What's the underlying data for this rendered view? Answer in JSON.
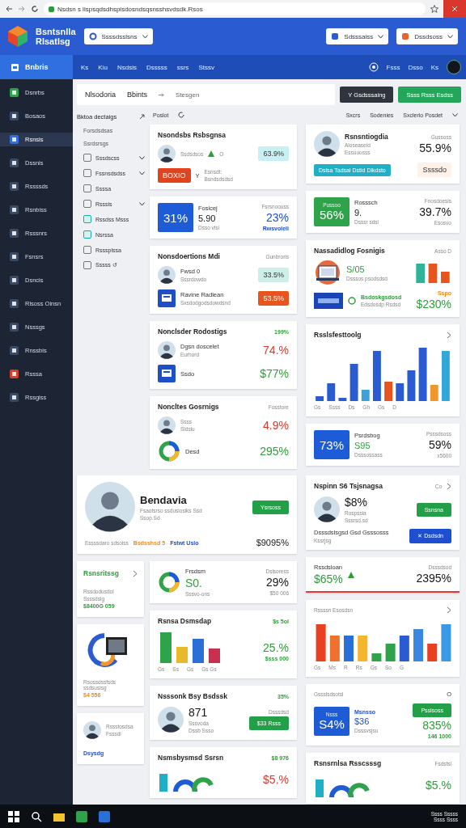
{
  "browser": {
    "url": "Nsdsn s llspsqdsdhsplsdosndsqsnsshsvdsdk.Rsos"
  },
  "header": {
    "app_name": [
      "Bsntsnlla",
      "Rlsatlsg"
    ],
    "workspace_select": "Ssssdsslsns",
    "right_selects": [
      "Sdsssaiss",
      "Dssdsoss"
    ]
  },
  "nav": {
    "home": "Bnbris",
    "items": [
      "Ks",
      "Kiu",
      "Nsdsis",
      "Dsssss",
      "ssrs",
      "Stssv"
    ],
    "right_items": [
      "Fsss",
      "Dsso",
      "Ks"
    ]
  },
  "sidebar": {
    "items": [
      {
        "label": "Dsnrbs",
        "selected": false,
        "color": "#2fa34a"
      },
      {
        "label": "Bosaos",
        "selected": false,
        "color": "#3a4a63"
      },
      {
        "label": "Rsnsis",
        "selected": true,
        "color": "#2f6fe0"
      },
      {
        "label": "Dssnis",
        "selected": false,
        "color": "#3a4a63"
      },
      {
        "label": "Rssssds",
        "selected": false,
        "color": "#3a4a63"
      },
      {
        "label": "Rsnbiss",
        "selected": false,
        "color": "#3a4a63"
      },
      {
        "label": "Rsssnrs",
        "selected": false,
        "color": "#3a4a63"
      },
      {
        "label": "Fsnsrs",
        "selected": false,
        "color": "#3a4a63"
      },
      {
        "label": "Dsncis",
        "selected": false,
        "color": "#3a4a63"
      },
      {
        "label": "Rlsoss Oinsn",
        "selected": false,
        "color": "#3a4a63"
      },
      {
        "label": "Nsssgs",
        "selected": false,
        "color": "#3a4a63"
      },
      {
        "label": "Rnssbis",
        "selected": false,
        "color": "#3a4a63"
      },
      {
        "label": "Rsssa",
        "selected": false,
        "color": "#d6402b"
      },
      {
        "label": "Rssgiss",
        "selected": false,
        "color": "#3a4a63"
      }
    ]
  },
  "toolbar": {
    "breadcrumb": [
      "Nlsodoria",
      "Bbints",
      "Stesgen"
    ],
    "buttons": [
      {
        "label": "Y Gsdsssaing",
        "color": "#30343c"
      },
      {
        "label": "Ssss Rsss Esdss",
        "color": "#23a55a"
      }
    ]
  },
  "tree": {
    "title": "Bktoa dectaigs",
    "items": [
      {
        "label": "Forsdsdsas",
        "kind": "heading"
      },
      {
        "label": "Ssrdsrsgs",
        "kind": "heading"
      },
      {
        "label": "Sssdscss",
        "kind": "group"
      },
      {
        "label": "Fssnsdsdss",
        "kind": "group"
      },
      {
        "label": "Ssssa",
        "kind": "leaf"
      },
      {
        "label": "Rsssis",
        "kind": "group"
      },
      {
        "label": "Rssdss Msss",
        "kind": "teal"
      },
      {
        "label": "Nsrssa",
        "kind": "teal"
      },
      {
        "label": "Rsssplssa",
        "kind": "leaf"
      },
      {
        "label": "Sssss ↺",
        "kind": "leaf"
      }
    ]
  },
  "filter_bar": {
    "left": "Poslot",
    "right": [
      "Sxcrs",
      "Sodenies",
      "Sxclerio Posdet"
    ]
  },
  "columns": {
    "a": [
      {
        "rows": [
          {
            "left": [
              {
                "kind": "title",
                "text": "Nsondsbs Rsbsgnsa"
              }
            ]
          },
          {
            "left": [
              {
                "kind": "avatar"
              },
              {
                "kind": "muted",
                "text": "Ssdsdsos"
              },
              {
                "kind": "up-icon"
              },
              {
                "kind": "muted",
                "text": "O"
              }
            ],
            "right": [
              {
                "kind": "badge",
                "text": "63.9%",
                "color": "#c8f0f2"
              }
            ]
          },
          {
            "left": [
              {
                "kind": "badge",
                "text": "BOXIO",
                "color": "#e0431d"
              },
              {
                "kind": "text",
                "text": "Y"
              },
              {
                "kind": "stack",
                "lines": [
                  {
                    "kind": "muted",
                    "text": "Esnsdt:"
                  },
                  {
                    "kind": "muted",
                    "text": "Bsndsdsdsd"
                  }
                ]
              }
            ]
          }
        ]
      },
      {
        "rows": [
          {
            "left": [
              {
                "kind": "tile",
                "color": "#1e5bd6",
                "lines": [
                  {
                    "kind": "tile-value",
                    "text": "31%"
                  }
                ]
              },
              {
                "kind": "stack",
                "lines": [
                  {
                    "kind": "text",
                    "text": "Fosicej"
                  },
                  {
                    "kind": "value-sm",
                    "text": "5.90"
                  },
                  {
                    "kind": "muted",
                    "text": "Dsso vlsi"
                  }
                ]
              }
            ],
            "right": [
              {
                "kind": "stack",
                "lines": [
                  {
                    "kind": "muted",
                    "text": "Fsrsnoouss"
                  },
                  {
                    "kind": "value-blue",
                    "text": "23%"
                  },
                  {
                    "kind": "small-blue",
                    "text": "Rwsvoleli"
                  }
                ]
              }
            ]
          }
        ]
      },
      {
        "rows": [
          {
            "left": [
              {
                "kind": "title",
                "text": "Nonsdoertions Mdi"
              }
            ],
            "right": [
              {
                "kind": "muted",
                "text": "Gunbroris"
              }
            ]
          },
          {
            "left": [
              {
                "kind": "avatar"
              },
              {
                "kind": "stack",
                "lines": [
                  {
                    "kind": "text",
                    "text": "Fwsd 0"
                  },
                  {
                    "kind": "muted",
                    "text": "Sssrdowdo"
                  }
                ]
              }
            ],
            "right": [
              {
                "kind": "badge",
                "text": "33.5%",
                "color": "#cdeee9"
              }
            ]
          },
          {
            "left": [
              {
                "kind": "app-icon"
              },
              {
                "kind": "stack",
                "lines": [
                  {
                    "kind": "text",
                    "text": "Ravine Radlean"
                  },
                  {
                    "kind": "muted",
                    "text": "Sxsdodgodsdowdsnd"
                  }
                ]
              }
            ],
            "right": [
              {
                "kind": "badge",
                "text": "53.5%",
                "color": "#e8541e"
              }
            ]
          }
        ]
      },
      {
        "rows": [
          {
            "left": [
              {
                "kind": "title",
                "text": "Nonclsder Rodostigs"
              }
            ],
            "right": [
              {
                "kind": "small-green",
                "text": "199%"
              }
            ]
          },
          {
            "left": [
              {
                "kind": "avatar"
              },
              {
                "kind": "stack",
                "lines": [
                  {
                    "kind": "text",
                    "text": "Dgsn doscelet"
                  },
                  {
                    "kind": "muted",
                    "text": "Eurhord"
                  }
                ]
              }
            ],
            "right": [
              {
                "kind": "value-red",
                "text": "74.%"
              }
            ]
          },
          {
            "left": [
              {
                "kind": "app-icon"
              },
              {
                "kind": "text",
                "text": "Ssdo"
              }
            ],
            "right": [
              {
                "kind": "value-green",
                "text": "$77%"
              }
            ]
          }
        ]
      },
      {
        "rows": [
          {
            "left": [
              {
                "kind": "title",
                "text": "Noncltes Gosrnigs"
              }
            ],
            "right": [
              {
                "kind": "muted",
                "text": "Fosstore"
              }
            ]
          },
          {
            "left": [
              {
                "kind": "avatar"
              },
              {
                "kind": "stack",
                "lines": [
                  {
                    "kind": "muted",
                    "text": "Ssss"
                  },
                  {
                    "kind": "muted",
                    "text": "Sldsiu"
                  }
                ]
              }
            ],
            "right": [
              {
                "kind": "value-red",
                "text": "4.9%"
              }
            ]
          },
          {
            "left": [
              {
                "kind": "donut-drawing"
              },
              {
                "kind": "text",
                "text": "Desd"
              }
            ],
            "right": [
              {
                "kind": "value-green",
                "text": "295%"
              }
            ]
          }
        ]
      }
    ],
    "b": [
      {
        "rows": [
          {
            "left": [
              {
                "kind": "avatar-lg"
              },
              {
                "kind": "stack",
                "lines": [
                  {
                    "kind": "title",
                    "text": "Rsnsntiogdia"
                  },
                  {
                    "kind": "muted",
                    "text": "Aloseaseld"
                  },
                  {
                    "kind": "muted",
                    "text": "Essuuosss"
                  }
                ]
              }
            ],
            "right": [
              {
                "kind": "stack",
                "lines": [
                  {
                    "kind": "muted",
                    "text": "Gussoss"
                  },
                  {
                    "kind": "value",
                    "text": "55.9%"
                  }
                ]
              }
            ]
          },
          {
            "left": [
              {
                "kind": "badge",
                "text": "Dslsa Tadsal Dstid Dikdsto",
                "color": "#1fb0c8"
              }
            ],
            "right": [
              {
                "kind": "badge",
                "text": "Ssssdo",
                "color": "#fdf1e8"
              }
            ]
          }
        ]
      },
      {
        "rows": [
          {
            "left": [
              {
                "kind": "tile",
                "color": "#2fa34a",
                "lines": [
                  {
                    "kind": "tile-small",
                    "text": "Pussoo"
                  },
                  {
                    "kind": "tile-value",
                    "text": "56%"
                  }
                ]
              },
              {
                "kind": "stack",
                "lines": [
                  {
                    "kind": "text",
                    "text": "Rosssch"
                  },
                  {
                    "kind": "value-sm",
                    "text": "9."
                  },
                  {
                    "kind": "muted",
                    "text": "Dsssr sdsi"
                  }
                ]
              }
            ],
            "right": [
              {
                "kind": "stack",
                "lines": [
                  {
                    "kind": "muted",
                    "text": "Fnosdoesis"
                  },
                  {
                    "kind": "value",
                    "text": "39.7%"
                  },
                  {
                    "kind": "muted",
                    "text": "Esosvo"
                  }
                ]
              }
            ]
          }
        ]
      },
      {
        "rows": [
          {
            "left": [
              {
                "kind": "title",
                "text": "Nassadidlog Fosnigis"
              }
            ],
            "right": [
              {
                "kind": "muted",
                "text": "Asso D"
              }
            ]
          },
          {
            "left": [
              {
                "kind": "device-drawing"
              },
              {
                "kind": "stack",
                "lines": [
                  {
                    "kind": "value-green-sm",
                    "text": "S/05"
                  },
                  {
                    "kind": "muted",
                    "text": "Dsssos psodsdsd"
                  }
                ]
              }
            ],
            "right": [
              {
                "kind": "bars-mini"
              }
            ]
          },
          {
            "left": [
              {
                "kind": "logo-tile"
              },
              {
                "kind": "dollar-icon"
              },
              {
                "kind": "stack",
                "lines": [
                  {
                    "kind": "small-green",
                    "text": "Bsdoskgsdosd"
                  },
                  {
                    "kind": "muted",
                    "text": "Edsdosdp Rsdsd"
                  }
                ]
              }
            ],
            "right": [
              {
                "kind": "stack",
                "lines": [
                  {
                    "kind": "small-orange",
                    "text": "Sspo"
                  },
                  {
                    "kind": "value-green",
                    "text": "$230%"
                  }
                ]
              }
            ]
          }
        ]
      },
      {
        "rows": [
          {
            "left": [
              {
                "kind": "title",
                "text": "Rsslsfesttoolg"
              }
            ],
            "right": [
              {
                "kind": "chevron-icon"
              }
            ]
          },
          {
            "left": [
              {
                "kind": "bars-large",
                "labels": [
                  "Gs",
                  "Ssss",
                  "Ds",
                  "Gh",
                  "Gs",
                  "D"
                ]
              }
            ]
          }
        ]
      },
      {
        "rows": [
          {
            "left": [
              {
                "kind": "tile",
                "color": "#1e5bd6",
                "lines": [
                  {
                    "kind": "tile-value",
                    "text": "73%"
                  }
                ]
              },
              {
                "kind": "stack",
                "lines": [
                  {
                    "kind": "text",
                    "text": "Psrdsbog"
                  },
                  {
                    "kind": "value-green-sm",
                    "text": "S95"
                  },
                  {
                    "kind": "muted",
                    "text": "Dsssossass"
                  }
                ]
              }
            ],
            "right": [
              {
                "kind": "stack",
                "lines": [
                  {
                    "kind": "muted",
                    "text": "Psssdsoss"
                  },
                  {
                    "kind": "value",
                    "text": "59%"
                  },
                  {
                    "kind": "muted",
                    "text": "x5600"
                  }
                ]
              }
            ]
          }
        ]
      }
    ]
  },
  "bottom": {
    "profile": {
      "rows": [
        {
          "left": [
            {
              "kind": "avatar-xl"
            },
            {
              "kind": "stack",
              "lines": [
                {
                  "kind": "title-lg",
                  "text": "Bendavia"
                },
                {
                  "kind": "muted",
                  "text": "Fsaotsrso ssdusiosiks Ssd"
                },
                {
                  "kind": "muted",
                  "text": "Ssop.Sd"
                }
              ]
            }
          ],
          "right": [
            {
              "kind": "button",
              "text": "Ysrsoss",
              "color": "#23a047"
            }
          ]
        },
        {
          "left": [
            {
              "kind": "muted",
              "text": "Essssdaro sdsoiss"
            },
            {
              "kind": "small-orange",
              "text": "Bsdsshsd 5"
            },
            {
              "kind": "small-blue",
              "text": "Fstwt Uslo"
            }
          ],
          "right": [
            {
              "kind": "value-sm",
              "text": "$9095%"
            }
          ]
        }
      ]
    },
    "narrow": [
      {
        "rows": [
          {
            "left": [
              {
                "kind": "title-green",
                "text": "Rsnsritssg"
              }
            ],
            "right": [
              {
                "kind": "chevron-icon"
              }
            ]
          },
          {
            "left": [
              {
                "kind": "stack",
                "lines": [
                  {
                    "kind": "muted",
                    "text": "Rssdodusdol"
                  },
                  {
                    "kind": "muted",
                    "text": "Ssssdsig"
                  },
                  {
                    "kind": "small-green",
                    "text": "$8400G 059"
                  }
                ]
              }
            ]
          }
        ]
      },
      {
        "rows": [
          {
            "left": [
              {
                "kind": "sync-drawing"
              }
            ]
          },
          {
            "left": [
              {
                "kind": "stack",
                "lines": [
                  {
                    "kind": "muted",
                    "text": "Rsossdssfsds ssdsusisg"
                  },
                  {
                    "kind": "small-orange",
                    "text": "$4 556"
                  }
                ]
              }
            ]
          }
        ]
      },
      {
        "rows": [
          {
            "left": [
              {
                "kind": "avatar"
              },
              {
                "kind": "stack",
                "lines": [
                  {
                    "kind": "muted",
                    "text": "Rssstosdsa"
                  },
                  {
                    "kind": "muted",
                    "text": "Fsssdi"
                  }
                ]
              }
            ]
          },
          {
            "left": [
              {
                "kind": "small-blue",
                "text": "Dsysdg"
              }
            ]
          }
        ]
      }
    ],
    "middle": [
      {
        "rows": [
          {
            "left": [
              {
                "kind": "donut-drawing"
              },
              {
                "kind": "stack",
                "lines": [
                  {
                    "kind": "text",
                    "text": "Frsdsm"
                  },
                  {
                    "kind": "value-green",
                    "text": "S0."
                  },
                  {
                    "kind": "muted",
                    "text": "Sssvo-ons"
                  }
                ]
              }
            ],
            "right": [
              {
                "kind": "stack",
                "lines": [
                  {
                    "kind": "muted",
                    "text": "Dslsoress"
                  },
                  {
                    "kind": "value",
                    "text": "29%"
                  },
                  {
                    "kind": "muted",
                    "text": "$50 006"
                  }
                ]
              }
            ]
          }
        ]
      },
      {
        "rows": [
          {
            "left": [
              {
                "kind": "title",
                "text": "Rsnsa Dsmsdap"
              }
            ],
            "right": [
              {
                "kind": "small-green",
                "text": "$s 5ol"
              }
            ]
          },
          {
            "left": [
              {
                "kind": "bars-small",
                "labels": [
                  "Gs",
                  "Ss",
                  "Gs",
                  "Gs Gs"
                ]
              }
            ],
            "right": [
              {
                "kind": "stack",
                "lines": [
                  {
                    "kind": "value-green",
                    "text": "25.%"
                  },
                  {
                    "kind": "small-green",
                    "text": "$sss 000"
                  }
                ]
              }
            ]
          }
        ]
      },
      {
        "rows": [
          {
            "left": [
              {
                "kind": "title",
                "text": "Nsssonk Bsy Bsdssk"
              }
            ],
            "right": [
              {
                "kind": "small-green",
                "text": "35%"
              }
            ]
          },
          {
            "left": [
              {
                "kind": "avatar-lg"
              },
              {
                "kind": "stack",
                "lines": [
                  {
                    "kind": "value",
                    "text": "871"
                  },
                  {
                    "kind": "muted",
                    "text": "Sssvoda"
                  },
                  {
                    "kind": "muted",
                    "text": "Dssb Ssso"
                  }
                ]
              }
            ],
            "right": [
              {
                "kind": "stack",
                "lines": [
                  {
                    "kind": "muted",
                    "text": "Dsssdsd"
                  },
                  {
                    "kind": "button",
                    "text": "$33 Rsss",
                    "color": "#23a047"
                  }
                ]
              }
            ]
          }
        ]
      },
      {
        "rows": [
          {
            "left": [
              {
                "kind": "title",
                "text": "Nsmsbysmsd Ssrsn"
              }
            ],
            "right": [
              {
                "kind": "small-green",
                "text": "$8 976"
              }
            ]
          },
          {
            "left": [
              {
                "kind": "ring-drawing"
              }
            ],
            "right": [
              {
                "kind": "value-red",
                "text": "$5.%"
              }
            ]
          }
        ]
      }
    ],
    "right": [
      {
        "rows": [
          {
            "left": [
              {
                "kind": "title",
                "text": "Nspinn S6 Tsjsnagsa"
              }
            ],
            "right": [
              {
                "kind": "muted",
                "text": "Co"
              },
              {
                "kind": "chevron-icon"
              }
            ]
          },
          {
            "left": [
              {
                "kind": "avatar-lg"
              },
              {
                "kind": "stack",
                "lines": [
                  {
                    "kind": "value",
                    "text": "$8%"
                  },
                  {
                    "kind": "muted",
                    "text": "Rospssia"
                  },
                  {
                    "kind": "muted",
                    "text": "Sssrsd.sd"
                  }
                ]
              }
            ],
            "right": [
              {
                "kind": "button",
                "text": "Ssnsna",
                "color": "#23a047"
              }
            ]
          },
          {
            "left": [
              {
                "kind": "stack",
                "lines": [
                  {
                    "kind": "text",
                    "text": "Dsssdslsgsd Gsd Gsssosss"
                  },
                  {
                    "kind": "muted",
                    "text": "Kssrjsg"
                  }
                ]
              }
            ],
            "right": [
              {
                "kind": "button",
                "text": "✕ Dsdsdn",
                "color": "#1e4fd0"
              }
            ]
          }
        ]
      },
      {
        "color": "#e53935",
        "rows": [
          {
            "left": [
              {
                "kind": "stack",
                "lines": [
                  {
                    "kind": "text",
                    "text": "Rssdsloan"
                  },
                  {
                    "kind": "value-green",
                    "text": "$65%"
                  }
                ]
              },
              {
                "kind": "up-icon"
              }
            ],
            "right": [
              {
                "kind": "stack",
                "lines": [
                  {
                    "kind": "muted",
                    "text": "Dsssdsod"
                  },
                  {
                    "kind": "value",
                    "text": "2395%"
                  }
                ]
              }
            ]
          }
        ]
      },
      {
        "rows": [
          {
            "left": [
              {
                "kind": "muted",
                "text": "Rssssn Esosdsn"
              }
            ],
            "right": [
              {
                "kind": "chevron-icon"
              }
            ]
          },
          {
            "left": [
              {
                "kind": "bars-wide",
                "labels": [
                  "Gs",
                  "Ms",
                  "R",
                  "Rs",
                  "Gs",
                  "So",
                  "G"
                ]
              }
            ]
          }
        ]
      },
      {
        "rows": [
          {
            "left": [
              {
                "kind": "muted",
                "text": "Gssslsdsotsl"
              }
            ],
            "right": [
              {
                "kind": "text",
                "text": "O"
              }
            ]
          },
          {
            "left": [
              {
                "kind": "tile",
                "color": "#1e5bd6",
                "lines": [
                  {
                    "kind": "tile-small",
                    "text": "Nsss"
                  },
                  {
                    "kind": "tile-value",
                    "text": "S4%"
                  }
                ]
              },
              {
                "kind": "stack",
                "lines": [
                  {
                    "kind": "small-blue",
                    "text": "Msnsso"
                  },
                  {
                    "kind": "value-blue-sm",
                    "text": "$36"
                  },
                  {
                    "kind": "muted",
                    "text": "Dsssvsjsu"
                  }
                ]
              }
            ],
            "right": [
              {
                "kind": "stack",
                "lines": [
                  {
                    "kind": "button",
                    "text": "Psslsoss",
                    "color": "#23a047"
                  },
                  {
                    "kind": "value-green",
                    "text": "835%"
                  },
                  {
                    "kind": "small-green",
                    "text": "146 1000"
                  }
                ]
              }
            ]
          }
        ]
      },
      {
        "rows": [
          {
            "left": [
              {
                "kind": "title",
                "text": "Rsnsrnlsa Rsscsssg"
              }
            ],
            "right": [
              {
                "kind": "muted",
                "text": "Fsdsfsl"
              }
            ]
          },
          {
            "left": [
              {
                "kind": "ring-drawing"
              }
            ],
            "right": [
              {
                "kind": "value-green",
                "text": "$5.%"
              }
            ]
          }
        ]
      }
    ]
  },
  "taskbar": {
    "tray": [
      "Ssss Sssss",
      "Ssss Ssss"
    ]
  }
}
